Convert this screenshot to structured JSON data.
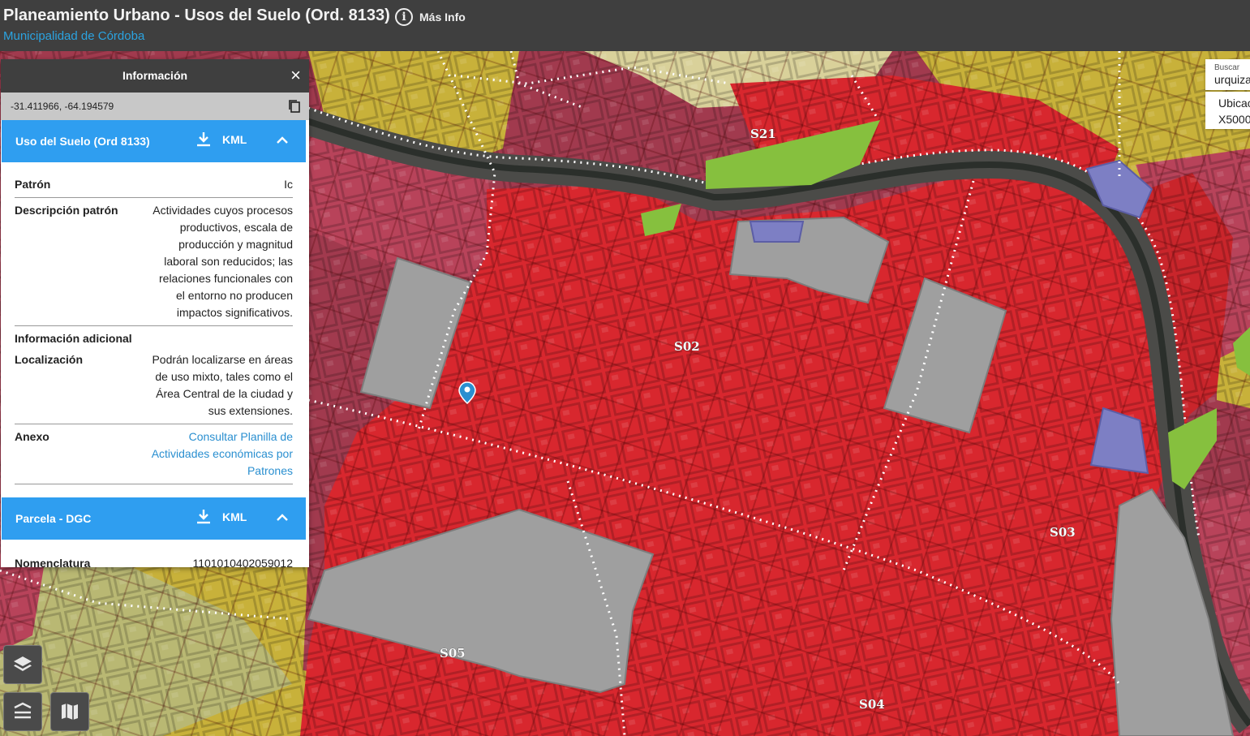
{
  "header": {
    "title": "Planeamiento Urbano - Usos del Suelo (Ord. 8133)",
    "subtitle": "Municipalidad de Córdoba",
    "info_label": "Más Info",
    "info_icon": "info-icon"
  },
  "panel": {
    "title": "Información",
    "close_glyph": "×",
    "coordinates": "-31.411966, -64.194579",
    "sections": [
      {
        "title": "Uso del Suelo (Ord 8133)",
        "kml_label": "KML",
        "expanded": true,
        "rows": [
          {
            "key": "Patrón",
            "value": "Ic"
          },
          {
            "key": "Descripción patrón",
            "value": "Actividades cuyos procesos productivos, escala de producción y magnitud laboral son reducidos; las relaciones funcionales con el entorno no producen impactos significativos."
          },
          {
            "key": "Información adicional",
            "value": ""
          },
          {
            "key": "Localización",
            "value": "Podrán localizarse en áreas de uso mixto, tales como el Área Central de la ciudad y sus extensiones."
          },
          {
            "key": "Anexo",
            "value": "Consultar Planilla de Actividades económicas por Patrones"
          }
        ]
      },
      {
        "title": "Parcela - DGC",
        "kml_label": "KML",
        "expanded": true,
        "rows": [
          {
            "key": "Nomenclatura",
            "value": "1101010402059012"
          }
        ]
      }
    ]
  },
  "search": {
    "label": "Buscar",
    "value": "urquiza",
    "result_line1": "Ubicac",
    "result_line2": "X5000"
  },
  "map": {
    "zone_labels": [
      "S21",
      "S02",
      "S03",
      "S04",
      "S05"
    ],
    "colors": {
      "red_zone": "#d8272e",
      "pink_zone": "#b8435a",
      "yellow_zone": "#c8b13a",
      "green_zone": "#7cb83a",
      "grey_zone": "#9a9a9a",
      "blue_zone": "#7d7fc4",
      "marker": "#2a8fd0"
    }
  },
  "controls": {
    "layers_icon": "layers-icon",
    "legend_icon": "legend-icon",
    "basemap_icon": "map-icon"
  }
}
